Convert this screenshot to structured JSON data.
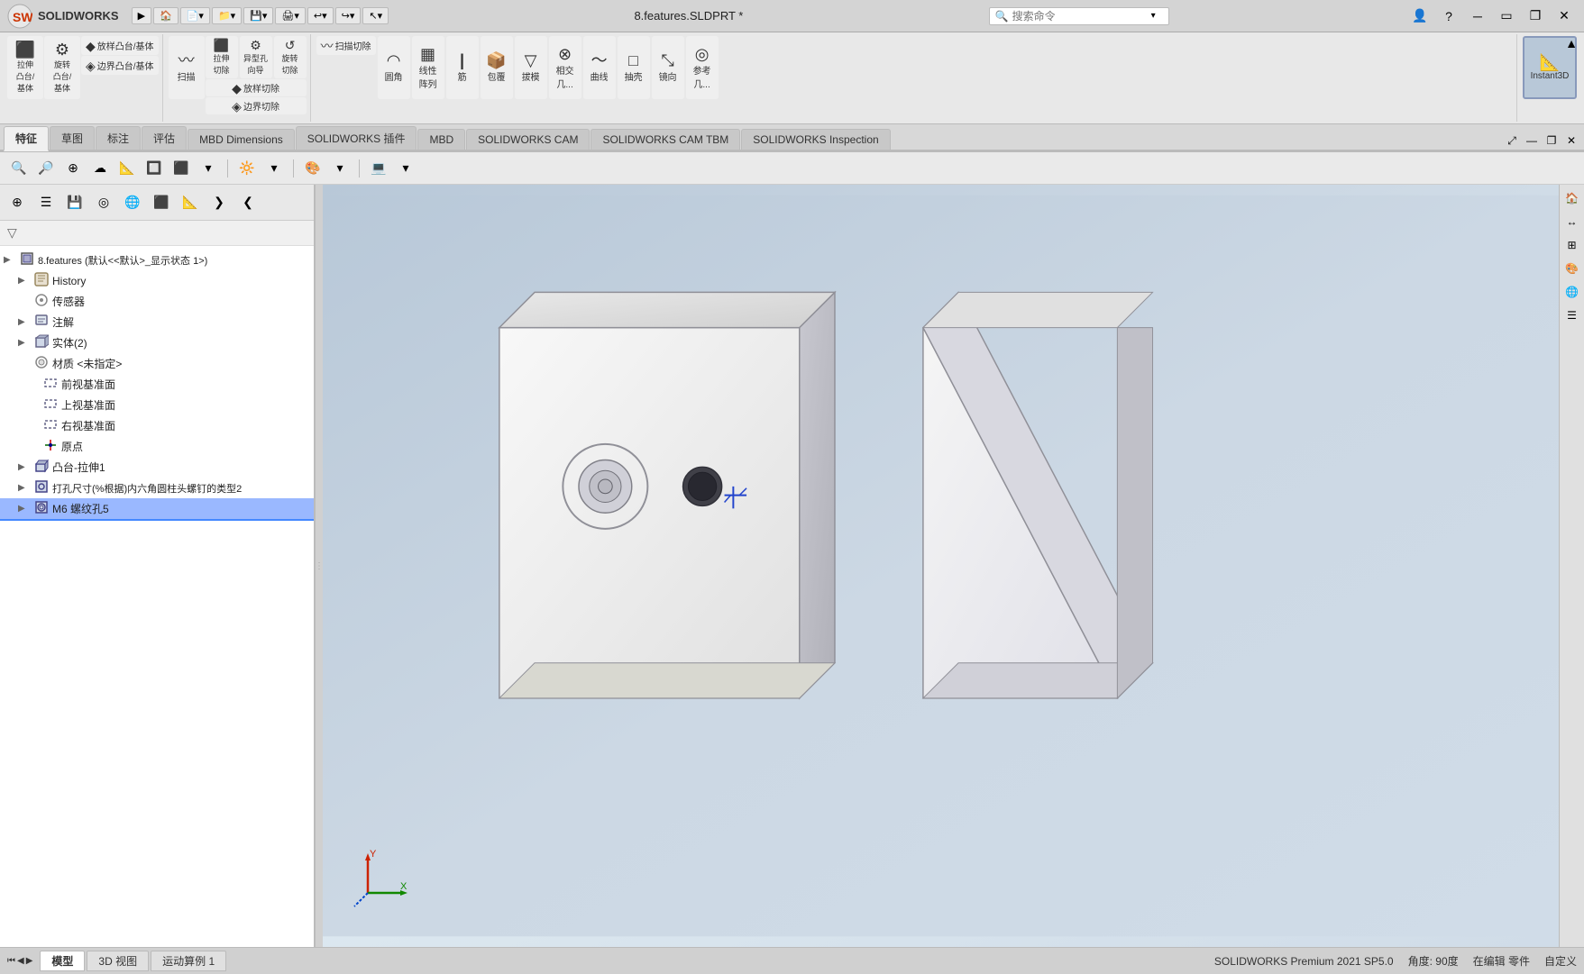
{
  "app": {
    "name": "SOLIDWORKS",
    "edition": "SOLIDWORKS Premium 2021 SP5.0",
    "file_title": "8.features.SLDPRT *"
  },
  "titlebar": {
    "brand": "SOLIDWORKS",
    "file": "8.features.SLDPRT *",
    "search_placeholder": "搜索命令",
    "nav_buttons": [
      "▶",
      "🏠",
      "📄",
      "📁",
      "💾",
      "🖨",
      "↩",
      "↪",
      "↖"
    ]
  },
  "toolbar": {
    "groups": [
      {
        "name": "extrude-group",
        "items": [
          {
            "label": "拉伸\n凸台/\n基体",
            "icon": "⬛"
          },
          {
            "label": "旋转\n凸台/\n基体",
            "icon": "⚙"
          },
          {
            "label": "放样凸台/基体",
            "icon": "◆"
          },
          {
            "label": "边界凸台/基体",
            "icon": "◈"
          }
        ]
      },
      {
        "name": "sweep-group",
        "items": [
          {
            "label": "扫描",
            "icon": "〰"
          },
          {
            "label": "拉伸\n切除",
            "icon": "⬛"
          },
          {
            "label": "异型孔\n向导",
            "icon": "⚙"
          },
          {
            "label": "旋转\n切除",
            "icon": "↺"
          },
          {
            "label": "放样切除",
            "icon": "◆"
          },
          {
            "label": "边界切除",
            "icon": "◈"
          }
        ]
      },
      {
        "name": "fillet-group",
        "items": [
          {
            "label": "扫描切除",
            "icon": "〰"
          },
          {
            "label": "圆角",
            "icon": "◠"
          },
          {
            "label": "线性\n阵列",
            "icon": "▦"
          },
          {
            "label": "筋",
            "icon": "|"
          },
          {
            "label": "包覆",
            "icon": "📦"
          },
          {
            "label": "拔模",
            "icon": "▽"
          },
          {
            "label": "相交\n几...",
            "icon": "⊗"
          },
          {
            "label": "曲线",
            "icon": "〜"
          },
          {
            "label": "抽壳",
            "icon": "□"
          },
          {
            "label": "镜向",
            "icon": "⤡"
          },
          {
            "label": "参考\n几...",
            "icon": "◎"
          }
        ]
      },
      {
        "name": "instant3d-group",
        "items": [
          {
            "label": "Instant3D",
            "icon": "📐",
            "highlighted": true
          }
        ]
      }
    ]
  },
  "tabs": {
    "items": [
      "特征",
      "草图",
      "标注",
      "评估",
      "MBD Dimensions",
      "SOLIDWORKS 插件",
      "MBD",
      "SOLIDWORKS CAM",
      "SOLIDWORKS CAM TBM",
      "SOLIDWORKS Inspection"
    ],
    "active": "特征"
  },
  "secondary_toolbar": {
    "icons": [
      "🔍",
      "🔎",
      "⊕",
      "☁",
      "📐",
      "🔲",
      "⬛",
      "🔆",
      "🎨",
      "💻"
    ]
  },
  "feature_tree": {
    "root_label": "8.features  (默认<<默认>_显示状态 1>)",
    "items": [
      {
        "id": "history",
        "label": "History",
        "icon": "📋",
        "indent": 0,
        "expandable": true
      },
      {
        "id": "sensors",
        "label": "传感器",
        "icon": "📡",
        "indent": 1,
        "expandable": false
      },
      {
        "id": "annotations",
        "label": "注解",
        "icon": "📝",
        "indent": 0,
        "expandable": true
      },
      {
        "id": "solids",
        "label": "实体(2)",
        "icon": "⬜",
        "indent": 0,
        "expandable": true
      },
      {
        "id": "material",
        "label": "材质 <未指定>",
        "icon": "⚙",
        "indent": 0,
        "expandable": false
      },
      {
        "id": "front-plane",
        "label": "前视基准面",
        "icon": "▭",
        "indent": 0,
        "expandable": false
      },
      {
        "id": "top-plane",
        "label": "上视基准面",
        "icon": "▭",
        "indent": 0,
        "expandable": false
      },
      {
        "id": "right-plane",
        "label": "右视基准面",
        "icon": "▭",
        "indent": 0,
        "expandable": false
      },
      {
        "id": "origin",
        "label": "原点",
        "icon": "✚",
        "indent": 0,
        "expandable": false
      },
      {
        "id": "boss-extrude1",
        "label": "凸台-拉伸1",
        "icon": "⬛",
        "indent": 0,
        "expandable": true
      },
      {
        "id": "hole-wizard",
        "label": "打孔尺寸(%根据)内六角圆柱头螺钉的类型2",
        "icon": "⚙",
        "indent": 0,
        "expandable": true
      },
      {
        "id": "m6-thread",
        "label": "M6 螺纹孔5",
        "icon": "⚙",
        "indent": 0,
        "expandable": true,
        "selected": true
      }
    ]
  },
  "panel_toolbar": {
    "icons": [
      "⊕",
      "☰",
      "💾",
      "◎",
      "🌐",
      "⬛",
      "📐",
      "❯",
      "❮"
    ]
  },
  "status_bar": {
    "text_left": "SOLIDWORKS Premium 2021 SP5.0",
    "angle": "角度: 90度",
    "mode": "在编辑 零件",
    "custom": "自定义",
    "bottom_tabs": [
      "模型",
      "3D 视图",
      "运动算例 1"
    ]
  },
  "viewport": {
    "bg_color_top": "#c8d4e0",
    "bg_color_bottom": "#dce8f0"
  }
}
